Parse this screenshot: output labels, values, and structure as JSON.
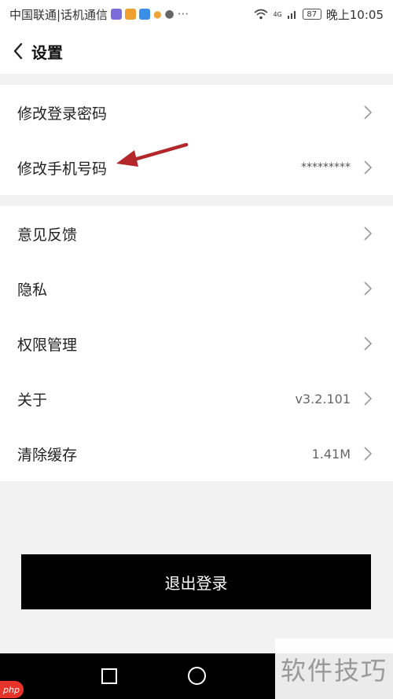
{
  "status_bar": {
    "carrier": "中国联通|话机通信",
    "network": "4G",
    "battery": "87",
    "time": "晚上10:05"
  },
  "header": {
    "title": "设置"
  },
  "account_group": [
    {
      "label": "修改登录密码",
      "value": ""
    },
    {
      "label": "修改手机号码",
      "value": "*********"
    }
  ],
  "general_group": [
    {
      "label": "意见反馈",
      "value": ""
    },
    {
      "label": "隐私",
      "value": ""
    },
    {
      "label": "权限管理",
      "value": ""
    },
    {
      "label": "关于",
      "value": "v3.2.101"
    },
    {
      "label": "清除缓存",
      "value": "1.41M"
    }
  ],
  "logout": {
    "label": "退出登录"
  },
  "watermark": {
    "text": "软件技巧",
    "badge": "php"
  },
  "colors": {
    "annotation_arrow": "#b3262a",
    "logout_bg": "#000000"
  }
}
